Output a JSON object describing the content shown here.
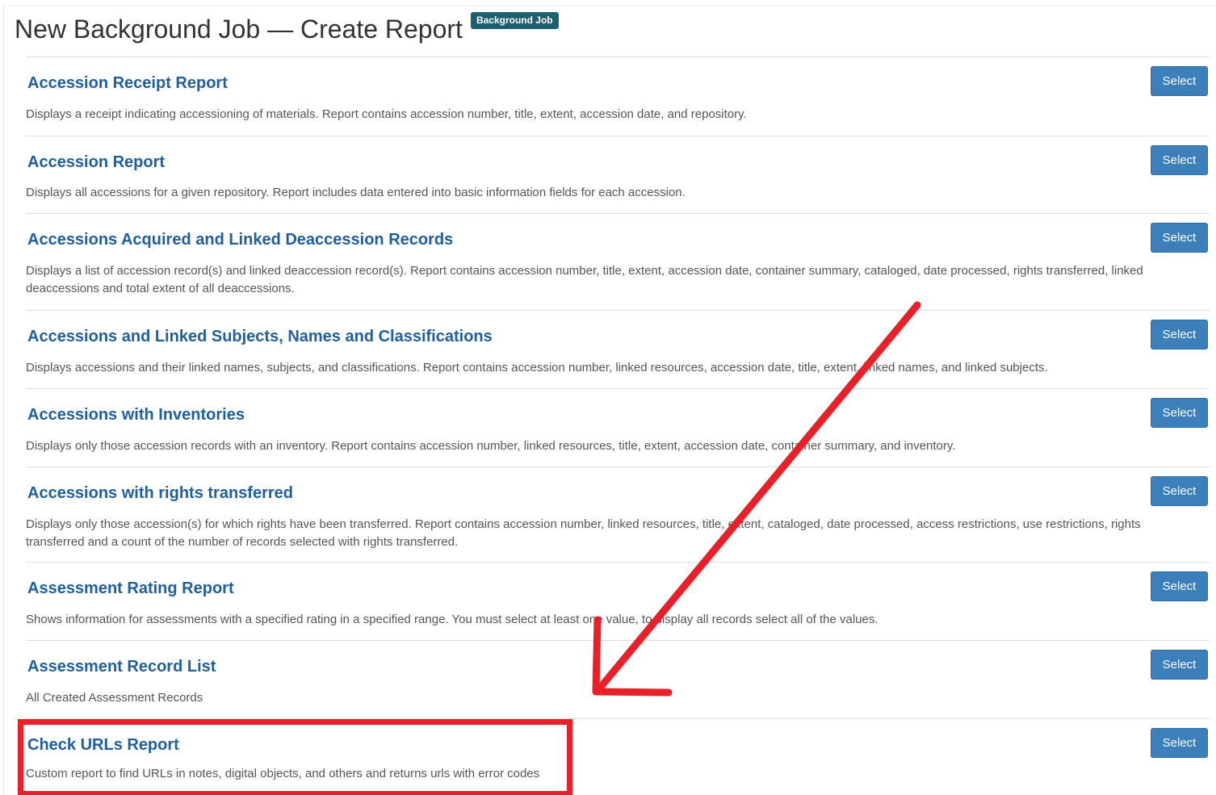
{
  "header": {
    "title": "New Background Job — Create Report",
    "badge": "Background Job"
  },
  "reports": [
    {
      "title": "Accession Receipt Report",
      "description": "Displays a receipt indicating accessioning of materials. Report contains accession number, title, extent, accession date, and repository.",
      "button_label": "Select"
    },
    {
      "title": "Accession Report",
      "description": "Displays all accessions for a given repository. Report includes data entered into basic information fields for each accession.",
      "button_label": "Select"
    },
    {
      "title": "Accessions Acquired and Linked Deaccession Records",
      "description": "Displays a list of accession record(s) and linked deaccession record(s). Report contains accession number, title, extent, accession date, container summary, cataloged, date processed, rights transferred, linked deaccessions and total extent of all deaccessions.",
      "button_label": "Select"
    },
    {
      "title": "Accessions and Linked Subjects, Names and Classifications",
      "description": "Displays accessions and their linked names, subjects, and classifications. Report contains accession number, linked resources, accession date, title, extent, linked names, and linked subjects.",
      "button_label": "Select"
    },
    {
      "title": "Accessions with Inventories",
      "description": "Displays only those accession records with an inventory. Report contains accession number, linked resources, title, extent, accession date, container summary, and inventory.",
      "button_label": "Select"
    },
    {
      "title": "Accessions with rights transferred",
      "description": "Displays only those accession(s) for which rights have been transferred. Report contains accession number, linked resources, title, extent, cataloged, date processed, access restrictions, use restrictions, rights transferred and a count of the number of records selected with rights transferred.",
      "button_label": "Select"
    },
    {
      "title": "Assessment Rating Report",
      "description": "Shows information for assessments with a specified rating in a specified range. You must select at least one value, to display all records select all of the values.",
      "button_label": "Select"
    },
    {
      "title": "Assessment Record List",
      "description": "All Created Assessment Records",
      "button_label": "Select"
    },
    {
      "title": "Check URLs Report",
      "description": "Custom report to find URLs in notes, digital objects, and others and returns urls with error codes",
      "button_label": "Select"
    }
  ],
  "annotation": {
    "color": "#e8202a"
  }
}
